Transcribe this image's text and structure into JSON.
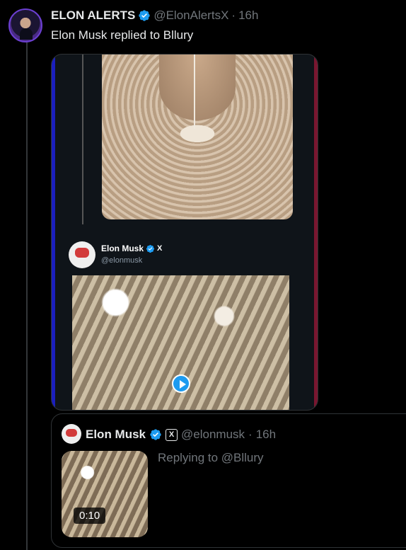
{
  "tweet": {
    "author_name": "ELON ALERTS",
    "author_handle": "@ElonAlertsX",
    "time": "16h",
    "separator": "·",
    "text": "Elon Musk replied to Bllury"
  },
  "embedded_card": {
    "author_name": "Elon Musk",
    "x_label": "X",
    "author_handle": "@elonmusk"
  },
  "quoted": {
    "author_name": "Elon Musk",
    "x_label": "X",
    "author_handle": "@elonmusk",
    "time": "16h",
    "separator": "·",
    "replying_to": "Replying to @Bllury",
    "video_duration": "0:10"
  },
  "colors": {
    "accent": "#1d9bf0",
    "muted_text": "#71767b",
    "border": "#2f3336"
  },
  "icons": [
    "verified-badge-icon",
    "play-icon",
    "x-logo-icon"
  ]
}
